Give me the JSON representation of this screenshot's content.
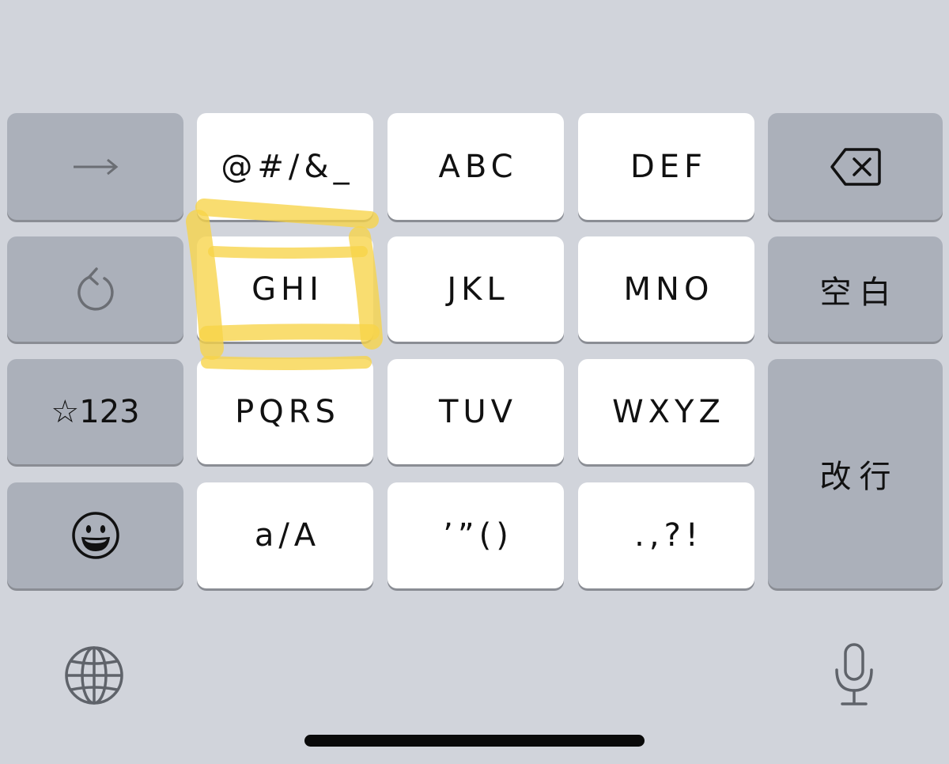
{
  "keyboard": {
    "left_column": {
      "next": {
        "icon": "arrow-right-icon"
      },
      "undo": {
        "icon": "undo-icon"
      },
      "symbols": {
        "label": "☆123"
      },
      "emoji": {
        "icon": "emoji-face-icon"
      }
    },
    "grid": {
      "symbols": "@#/&_",
      "abc": "ABC",
      "def": "DEF",
      "ghi": "GHI",
      "jkl": "JKL",
      "mno": "MNO",
      "pqrs": "PQRS",
      "tuv": "TUV",
      "wxyz": "WXYZ",
      "case": "a/A",
      "quotes": "’”()",
      "punct": ".,?!"
    },
    "right_column": {
      "delete": {
        "icon": "backspace-icon"
      },
      "space": {
        "label": "空白"
      },
      "return": {
        "label": "改行"
      }
    },
    "highlight": {
      "target": "ghi-key",
      "color": "#f7d348"
    }
  },
  "bottom_bar": {
    "globe": {
      "icon": "globe-icon"
    },
    "mic": {
      "icon": "microphone-icon"
    }
  },
  "colors": {
    "background": "#d1d4db",
    "light_key": "#ffffff",
    "dark_key": "#abb0ba",
    "key_shadow": "#8a8d94"
  }
}
